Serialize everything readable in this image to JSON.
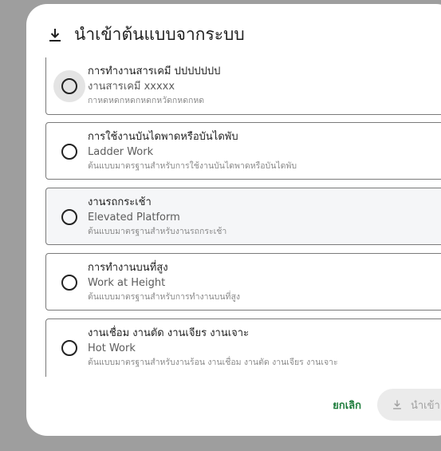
{
  "dialog": {
    "title": "นำเข้าต้นแบบจากระบบ",
    "title_icon": "download-icon"
  },
  "templates": [
    {
      "name_th": "การทำงานสารเคมี ปปปปปปป",
      "name_en": "งานสารเคมี xxxxx",
      "description": "กาหดหดกหดกหดกหวัดกหดกหด",
      "selected": false
    },
    {
      "name_th": "การใช้งานบันไดพาดหรือบันไดพับ",
      "name_en": "Ladder Work",
      "description": "ต้นแบบมาตรฐานสำหรับการใช้งานบันไดพาดหรือบันไดพับ",
      "selected": false
    },
    {
      "name_th": "งานรถกระเช้า",
      "name_en": "Elevated Platform",
      "description": "ต้นแบบมาตรฐานสำหรับงานรถกระเช้า",
      "selected": false
    },
    {
      "name_th": "การทำงานบนที่สูง",
      "name_en": "Work at Height",
      "description": "ต้นแบบมาตรฐานสำหรับการทำงานบนที่สูง",
      "selected": false
    },
    {
      "name_th": "งานเชื่อม งานตัด งานเจียร งานเจาะ",
      "name_en": "Hot Work",
      "description": "ต้นแบบมาตรฐานสำหรับงานร้อน งานเชื่อม งานตัด งานเจียร งานเจาะ",
      "selected": false
    }
  ],
  "footer": {
    "cancel_label": "ยกเลิก",
    "import_label": "นำเข้า",
    "import_icon": "download-icon",
    "accent_color": "#1e7d3c"
  }
}
